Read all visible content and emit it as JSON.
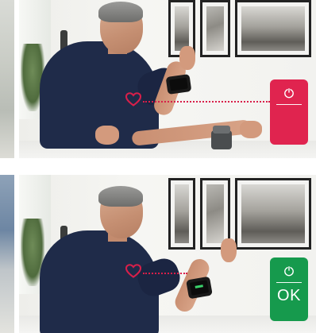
{
  "colors": {
    "alert_card": "#e0244f",
    "ok_card": "#169a4d",
    "heart_line": "#d91f4a",
    "shirt": "#1f2b49"
  },
  "icons": {
    "heart": "heart-outline-icon",
    "power": "power-icon"
  },
  "panels": [
    {
      "id": "measuring",
      "card_status": "alert",
      "card_text": ""
    },
    {
      "id": "result",
      "card_status": "ok",
      "card_text": "OK"
    }
  ]
}
